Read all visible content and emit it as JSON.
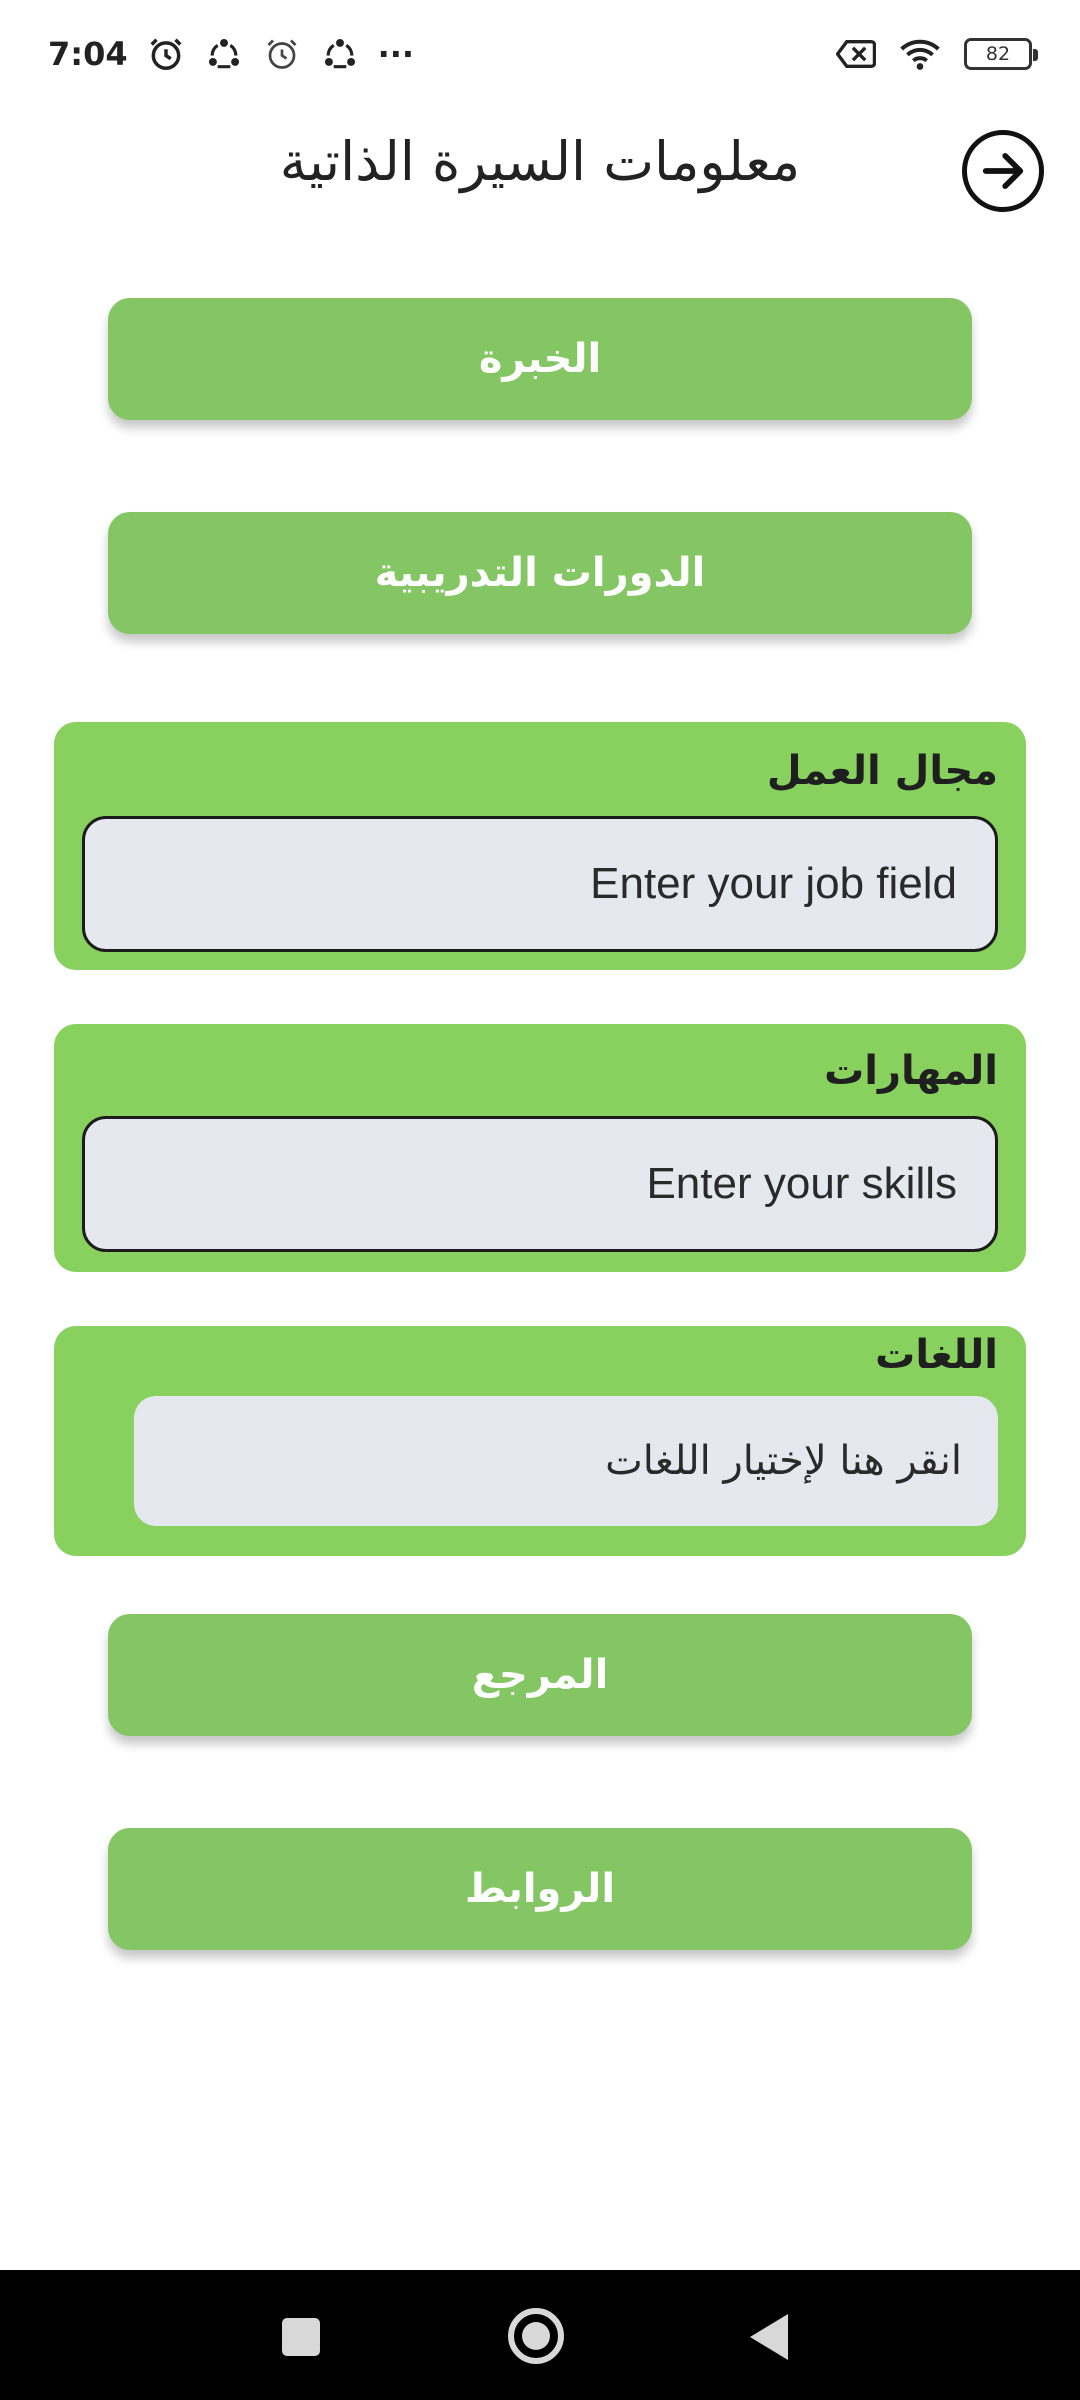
{
  "status_bar": {
    "time": "7:04",
    "battery": "82",
    "left_icons": [
      "alarm-icon",
      "sync-icon",
      "alarm-outline-icon",
      "sync-icon"
    ],
    "more": "···",
    "right_icons": [
      "no-sim-icon",
      "wifi-icon"
    ]
  },
  "header": {
    "title": "معلومات السيرة الذاتية",
    "back_icon": "arrow-right-circle-icon"
  },
  "buttons": {
    "experience": "الخبرة",
    "training_courses": "الدورات التدريبية",
    "reference": "المرجع",
    "links": "الروابط"
  },
  "job_field": {
    "label": "مجال العمل",
    "placeholder": "Enter your job field"
  },
  "skills": {
    "label": "المهارات",
    "placeholder": "Enter your skills"
  },
  "languages": {
    "label": "اللغات",
    "placeholder": "انقر هنا لإختيار اللغات"
  },
  "colors": {
    "button_green": "#84c663",
    "card_green": "#88d15e",
    "input_bg": "#e5e8ef"
  }
}
